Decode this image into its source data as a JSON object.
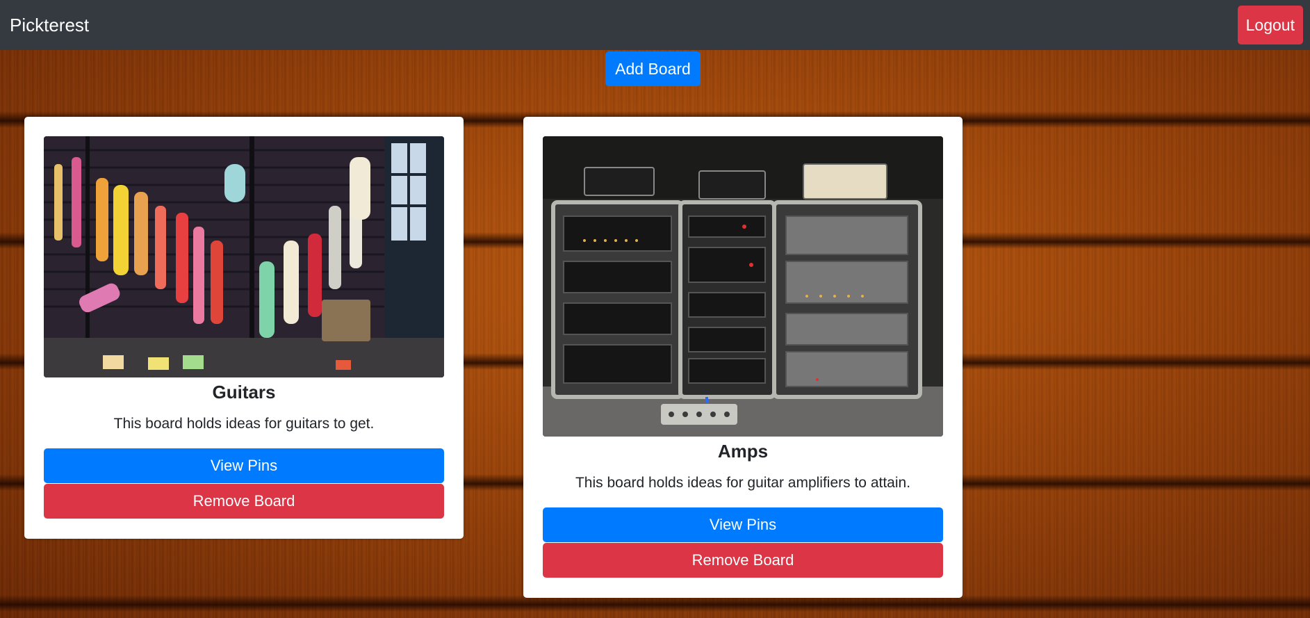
{
  "navbar": {
    "brand": "Pickterest",
    "logout_label": "Logout"
  },
  "add_board_label": "Add Board",
  "boards": [
    {
      "title": "Guitars",
      "description": "This board holds ideas for guitars to get.",
      "view_label": "View Pins",
      "remove_label": "Remove Board"
    },
    {
      "title": "Amps",
      "description": "This board holds ideas for guitar amplifiers to attain.",
      "view_label": "View Pins",
      "remove_label": "Remove Board"
    }
  ],
  "colors": {
    "navbar": "#343a40",
    "primary": "#007bff",
    "danger": "#dc3545"
  }
}
